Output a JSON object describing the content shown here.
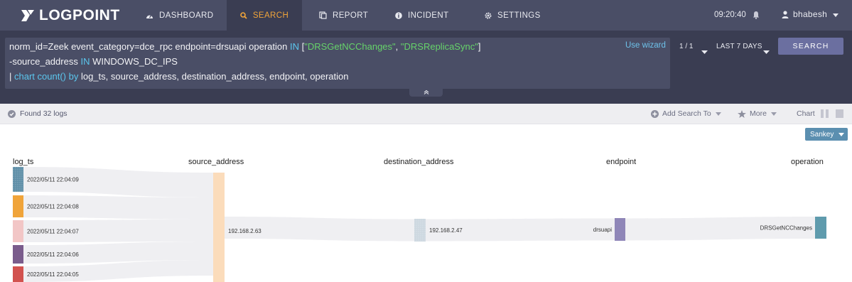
{
  "app": {
    "brand": "LOGPOINT"
  },
  "nav": {
    "tabs": [
      {
        "label": "DASHBOARD",
        "icon": "dashboard-gauge-icon"
      },
      {
        "label": "SEARCH",
        "icon": "search-icon",
        "active": true
      },
      {
        "label": "REPORT",
        "icon": "report-icon"
      },
      {
        "label": "INCIDENT",
        "icon": "info-icon"
      },
      {
        "label": "SETTINGS",
        "icon": "gear-icon"
      }
    ],
    "clock": "09:20:40",
    "user": "bhabesh"
  },
  "query": {
    "line1_a": "norm_id=Zeek event_category=dce_rpc endpoint=drsuapi operation ",
    "line1_in": "IN",
    "line1_b": " [",
    "line1_v1": "\"DRSGetNCChanges\"",
    "line1_c": ", ",
    "line1_v2": "\"DRSReplicaSync\"",
    "line1_d": "]",
    "line2_a": "-source_address ",
    "line2_in": "IN",
    "line2_b": " WINDOWS_DC_IPS",
    "line3_pipe": "| ",
    "line3_chart": "chart count()",
    "line3_sp": " ",
    "line3_by": "by",
    "line3_rest": " log_ts, source_address, destination_address, endpoint, operation",
    "wizard_link": "Use wizard",
    "pager": "1 / 1",
    "range": "LAST 7 DAYS",
    "search_button": "SEARCH"
  },
  "status": {
    "found": "Found 32 logs",
    "add_search": "Add Search To",
    "more": "More",
    "chart": "Chart"
  },
  "sankey_selector": "Sankey",
  "colors": {
    "nav_bg": "#4a4e66",
    "query_bg": "#3a3d52",
    "active_tab": "#f0a43a",
    "keyword_blue": "#5bc7ee",
    "keyword_green": "#66d36a",
    "search_button": "#6b6fa0"
  },
  "chart_data": {
    "type": "sankey",
    "columns": [
      "log_ts",
      "source_address",
      "destination_address",
      "endpoint",
      "operation"
    ],
    "nodes": [
      {
        "col": 0,
        "label": "2022/05/11 22:04:09",
        "color": "#5f8fa8",
        "pattern": true
      },
      {
        "col": 0,
        "label": "2022/05/11 22:04:08",
        "color": "#f0a43a"
      },
      {
        "col": 0,
        "label": "2022/05/11 22:04:07",
        "color": "#f2c6c6"
      },
      {
        "col": 0,
        "label": "2022/05/11 22:04:06",
        "color": "#7a5c8c"
      },
      {
        "col": 0,
        "label": "2022/05/11 22:04:05",
        "color": "#d2524f"
      },
      {
        "col": 1,
        "label": "192.168.2.63",
        "color": "#fbdcbb"
      },
      {
        "col": 2,
        "label": "192.168.2.47",
        "color": "#cdd8e0",
        "pattern": true
      },
      {
        "col": 3,
        "label": "drsuapi",
        "color": "#8f86b8"
      },
      {
        "col": 4,
        "label": "DRSGetNCChanges",
        "color": "#5f9bad"
      }
    ]
  }
}
